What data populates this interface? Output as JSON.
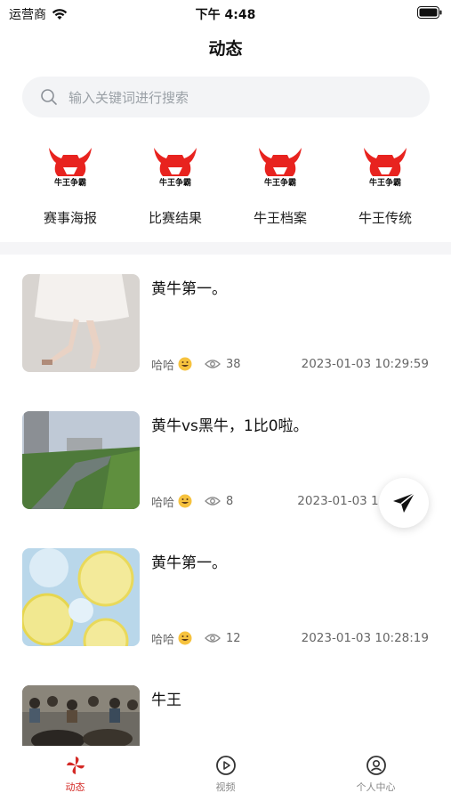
{
  "status_bar": {
    "carrier": "运营商",
    "time": "下午 4:48"
  },
  "nav": {
    "title": "动态"
  },
  "search": {
    "placeholder": "输入关键词进行搜索"
  },
  "categories": [
    {
      "label": "赛事海报",
      "logo_text": "牛王争霸"
    },
    {
      "label": "比赛结果",
      "logo_text": "牛王争霸"
    },
    {
      "label": "牛王档案",
      "logo_text": "牛王争霸"
    },
    {
      "label": "牛王传统",
      "logo_text": "牛王争霸"
    }
  ],
  "posts": [
    {
      "title": "黄牛第一。",
      "author": "哈哈",
      "views": "38",
      "date": "2023-01-03 10:29:59",
      "image": "dancer-legs"
    },
    {
      "title": "黄牛vs黑牛，1比0啦。",
      "author": "哈哈",
      "views": "8",
      "date": "2023-01-03 1",
      "image": "river-city"
    },
    {
      "title": "黄牛第一。",
      "author": "哈哈",
      "views": "12",
      "date": "2023-01-03 10:28:19",
      "image": "lemon-slices"
    },
    {
      "title": "牛王",
      "author": "",
      "views": "",
      "date": "",
      "image": "bullfight-crowd"
    }
  ],
  "fab": {
    "icon": "send-icon"
  },
  "tabs": [
    {
      "label": "动态",
      "icon": "pinwheel-icon",
      "active": true
    },
    {
      "label": "视频",
      "icon": "play-circle-icon",
      "active": false
    },
    {
      "label": "个人中心",
      "icon": "user-circle-icon",
      "active": false
    }
  ],
  "colors": {
    "accent": "#d42a26",
    "logo_red": "#e8231f",
    "text_gray": "#666666"
  }
}
